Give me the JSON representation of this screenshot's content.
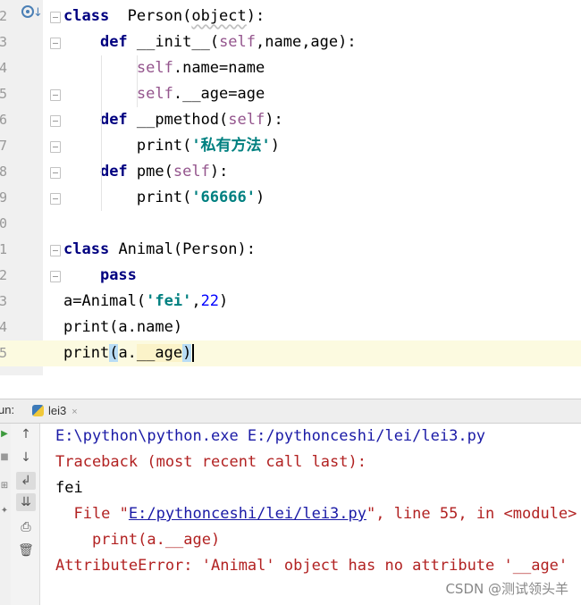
{
  "editor": {
    "lines": [
      {
        "n": "2",
        "code": [
          [
            "kw",
            "class"
          ],
          [
            "",
            "  "
          ],
          [
            "",
            "Person"
          ],
          [
            "",
            "("
          ],
          [
            "warn",
            "object"
          ],
          [
            "",
            "):"
          ]
        ]
      },
      {
        "n": "3",
        "code": [
          [
            "",
            "    "
          ],
          [
            "kw",
            "def"
          ],
          [
            "",
            " "
          ],
          [
            "",
            "__init__"
          ],
          [
            "",
            "("
          ],
          [
            "self",
            "self"
          ],
          [
            "",
            ",name,age):"
          ]
        ]
      },
      {
        "n": "4",
        "code": [
          [
            "",
            "        "
          ],
          [
            "self",
            "self"
          ],
          [
            "",
            ".name=name"
          ]
        ]
      },
      {
        "n": "5",
        "code": [
          [
            "",
            "        "
          ],
          [
            "self",
            "self"
          ],
          [
            "",
            ".__age=age"
          ]
        ]
      },
      {
        "n": "6",
        "code": [
          [
            "",
            "    "
          ],
          [
            "kw",
            "def"
          ],
          [
            "",
            " "
          ],
          [
            "",
            "__pmethod("
          ],
          [
            "self",
            "self"
          ],
          [
            "",
            "):"
          ]
        ]
      },
      {
        "n": "7",
        "code": [
          [
            "",
            "        "
          ],
          [
            "",
            "print("
          ],
          [
            "str",
            "'私有方法'"
          ],
          [
            "",
            ")"
          ]
        ]
      },
      {
        "n": "8",
        "code": [
          [
            "",
            "    "
          ],
          [
            "kw",
            "def"
          ],
          [
            "",
            " "
          ],
          [
            "",
            "pme("
          ],
          [
            "self",
            "self"
          ],
          [
            "",
            "):"
          ]
        ]
      },
      {
        "n": "9",
        "code": [
          [
            "",
            "        "
          ],
          [
            "",
            "print("
          ],
          [
            "str",
            "'66666'"
          ],
          [
            "",
            ")"
          ]
        ]
      },
      {
        "n": "0",
        "code": []
      },
      {
        "n": "1",
        "code": [
          [
            "kw",
            "class"
          ],
          [
            "",
            " "
          ],
          [
            "",
            "Animal(Person):"
          ]
        ]
      },
      {
        "n": "2",
        "code": [
          [
            "",
            "    "
          ],
          [
            "kw",
            "pass"
          ]
        ]
      },
      {
        "n": "3",
        "code": [
          [
            "",
            "a=Animal("
          ],
          [
            "str",
            "'fei'"
          ],
          [
            "",
            ","
          ],
          [
            "num",
            "22"
          ],
          [
            "",
            ")"
          ]
        ]
      },
      {
        "n": "4",
        "code": [
          [
            "",
            "print(a.name)"
          ]
        ]
      },
      {
        "n": "5",
        "code": [
          [
            "",
            "print"
          ],
          [
            "br",
            "("
          ],
          [
            "",
            "a."
          ],
          [
            "hl",
            "__age"
          ],
          [
            "br",
            ")"
          ]
        ]
      }
    ]
  },
  "run_panel": {
    "label": "un:",
    "tab_name": "lei3",
    "tab_close": "×"
  },
  "console": {
    "cmd": "E:\\python\\python.exe E:/pythonceshi/lei/lei3.py",
    "traceback": "Traceback (most recent call last):",
    "out": "fei",
    "file_prefix": "  File \"",
    "file_link": "E:/pythonceshi/lei/lei3.py",
    "file_suffix": "\", line 55, in <module>",
    "code_line": "    print(a.__age)",
    "error": "AttributeError: 'Animal' object has no attribute '__age'"
  },
  "watermark": "CSDN @测试领头羊",
  "colors": {
    "keyword": "#000080",
    "self": "#94558d",
    "string": "#008080",
    "number": "#0000ff",
    "error": "#b22222",
    "path": "#1a1aa6"
  }
}
